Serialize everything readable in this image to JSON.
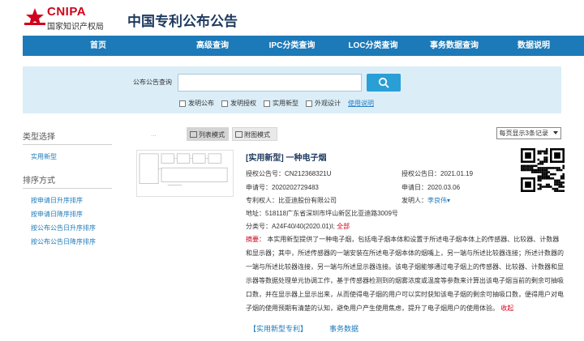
{
  "brand": {
    "logo_en": "CNIPA",
    "logo_cn": "国家知识产权局",
    "site_title": "中国专利公布公告"
  },
  "nav": {
    "items": [
      "首页",
      "高级查询",
      "IPC分类查询",
      "LOC分类查询",
      "事务数据查询",
      "数据说明"
    ]
  },
  "search": {
    "label": "公布公告查询",
    "placeholder": "",
    "checks": [
      "发明公布",
      "发明授权",
      "实用新型",
      "外观设计"
    ],
    "help": "使用说明"
  },
  "sidebar": {
    "type_title": "类型选择",
    "type_items": [
      "实用新型"
    ],
    "sort_title": "排序方式",
    "sort_items": [
      "按申请日升序排序",
      "按申请日降序排序",
      "按公布公告日升序排序",
      "按公布公告日降序排序"
    ]
  },
  "toolbar": {
    "dim_text": "...",
    "list_mode": "列表模式",
    "figure_mode": "附图模式",
    "per_page": "每页显示3条记录"
  },
  "record": {
    "title": "[实用新型] 一种电子烟",
    "grant_no_label": "授权公告号：",
    "grant_no": "CN212368321U",
    "grant_date_label": "授权公告日：",
    "grant_date": "2021.01.19",
    "app_no_label": "申请号：",
    "app_no": "2020202729483",
    "app_date_label": "申请日：",
    "app_date": "2020.03.06",
    "patentee_label": "专利权人：",
    "patentee": "比亚迪股份有限公司",
    "inventor_label": "发明人：",
    "inventor": "李良伟",
    "address_label": "地址：",
    "address": "518118广东省深圳市坪山新区比亚迪路3009号",
    "class_label": "分类号：",
    "class_no": "A24F40/40(2020.01)I",
    "class_all": "全部",
    "abstract_label": "摘要：",
    "abstract": "本实用新型提供了一种电子烟，包括电子烟本体和设置于所述电子烟本体上的传感器、比较器、计数器和显示器；其中，所述传感器的一端安装在所述电子烟本体的烟嘴上，另一端与所述比较器连接；所述计数器的一端与所述比较器连接，另一端与所述显示器连接。该电子烟能够通过电子烟上的传感器、比较器、计数器和显示器等数据处理单元协调工作，基于传感器检测到的烟雾浓度或温度等参数来计算出该电子烟当前的剩余可抽吸口数，并在显示器上显示出来，从而使得电子烟的用户可以实时获知该电子烟的剩余可抽吸口数，便得用户对电子烟的使用预期有清楚的认知，避免用户产生使用焦虑，提升了电子烟用户的使用体验。",
    "collapse": "收起",
    "link_patent": "【实用新型专利】",
    "link_affairs": "事务数据"
  }
}
